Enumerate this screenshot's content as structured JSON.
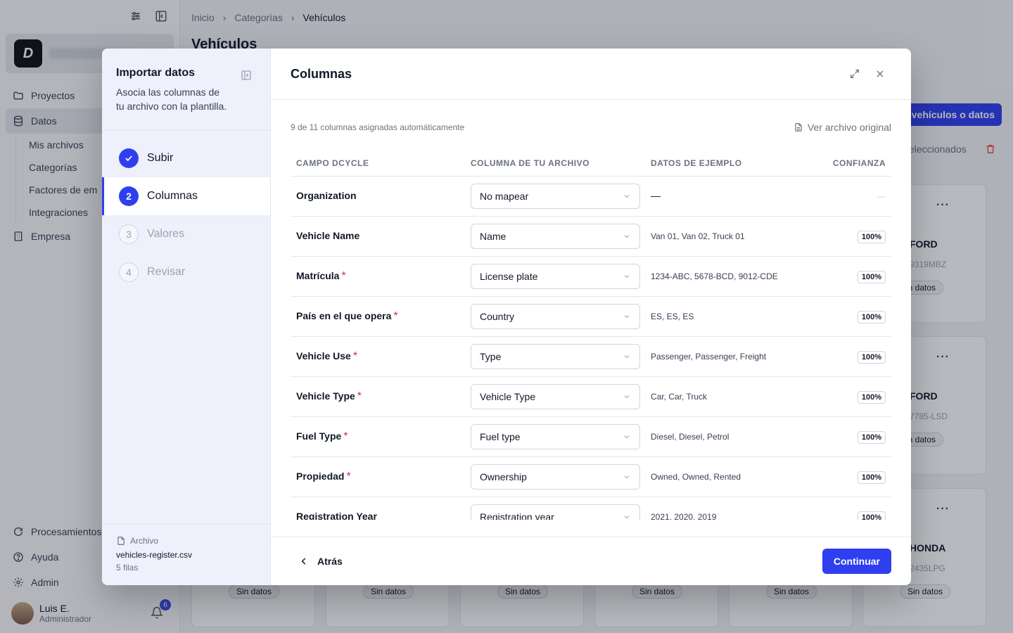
{
  "sidebar": {
    "nav_top": [
      {
        "label": "Proyectos",
        "icon": "folder-icon"
      },
      {
        "label": "Datos",
        "icon": "database-icon"
      }
    ],
    "nav_sub": [
      "Mis archivos",
      "Categorías",
      "Factores de em",
      "Integraciones"
    ],
    "nav_company": {
      "label": "Empresa",
      "icon": "building-icon"
    },
    "nav_bottom": [
      {
        "label": "Procesamientos",
        "icon": "refresh-icon"
      },
      {
        "label": "Ayuda",
        "icon": "help-icon"
      },
      {
        "label": "Admin",
        "icon": "gear-icon"
      }
    ],
    "user": {
      "name": "Luis E.",
      "role": "Administrador"
    },
    "notifications": "6"
  },
  "main": {
    "breadcrumb": [
      "Inicio",
      "Categorías",
      "Vehículos"
    ],
    "title": "Vehículos",
    "primary_action": "vehículos o datos",
    "selected_text": "eleccionados",
    "cards": [
      {
        "brand": "FORD",
        "plate": "9319MBZ",
        "status": "in datos"
      },
      {
        "brand": "FORD",
        "plate": "7785-LSD",
        "status": "in datos"
      },
      {
        "brand": "HONDA",
        "plate": "2435LPG",
        "status": "Sin datos"
      }
    ],
    "bottom_pills": [
      "Sin datos",
      "Sin datos",
      "Sin datos",
      "Sin datos",
      "Sin datos"
    ]
  },
  "modal": {
    "steps_title": "Importar datos",
    "steps_desc": "Asocia las columnas de tu archivo con la plantilla.",
    "steps": [
      {
        "num": "",
        "label": "Subir",
        "state": "done"
      },
      {
        "num": "2",
        "label": "Columnas",
        "state": "active"
      },
      {
        "num": "3",
        "label": "Valores",
        "state": "pending"
      },
      {
        "num": "4",
        "label": "Revisar",
        "state": "pending"
      }
    ],
    "file": {
      "label": "Archivo",
      "name": "vehicles-register.csv",
      "rows": "5 filas"
    },
    "title": "Columnas",
    "auto_text": "9 de 11 columnas asignadas automáticamente",
    "view_original": "Ver archivo original",
    "table": {
      "headers": [
        "CAMPO DCYCLE",
        "COLUMNA DE TU ARCHIVO",
        "DATOS DE EJEMPLO",
        "CONFIANZA"
      ],
      "rows": [
        {
          "field": "Organization",
          "required": false,
          "column": "No mapear",
          "sample": "—",
          "confidence": "—"
        },
        {
          "field": "Vehicle Name",
          "required": false,
          "column": "Name",
          "sample": "Van 01, Van 02, Truck 01",
          "confidence": "100%"
        },
        {
          "field": "Matrícula",
          "required": true,
          "column": "License plate",
          "sample": "1234-ABC, 5678-BCD, 9012-CDE",
          "confidence": "100%"
        },
        {
          "field": "País en el que opera",
          "required": true,
          "column": "Country",
          "sample": "ES, ES, ES",
          "confidence": "100%"
        },
        {
          "field": "Vehicle Use",
          "required": true,
          "column": "Type",
          "sample": "Passenger, Passenger, Freight",
          "confidence": "100%"
        },
        {
          "field": "Vehicle Type",
          "required": true,
          "column": "Vehicle Type",
          "sample": "Car, Car, Truck",
          "confidence": "100%"
        },
        {
          "field": "Fuel Type",
          "required": true,
          "column": "Fuel type",
          "sample": "Diesel, Diesel, Petrol",
          "confidence": "100%"
        },
        {
          "field": "Propiedad",
          "required": true,
          "column": "Ownership",
          "sample": "Owned, Owned, Rented",
          "confidence": "100%"
        },
        {
          "field": "Registration Year",
          "required": false,
          "column": "Registration year",
          "sample": "2021, 2020, 2019",
          "confidence": "100%"
        }
      ]
    },
    "back_label": "Atrás",
    "continue_label": "Continuar"
  },
  "colors": {
    "accent": "#2f3ff0",
    "required": "#e11d6a"
  }
}
